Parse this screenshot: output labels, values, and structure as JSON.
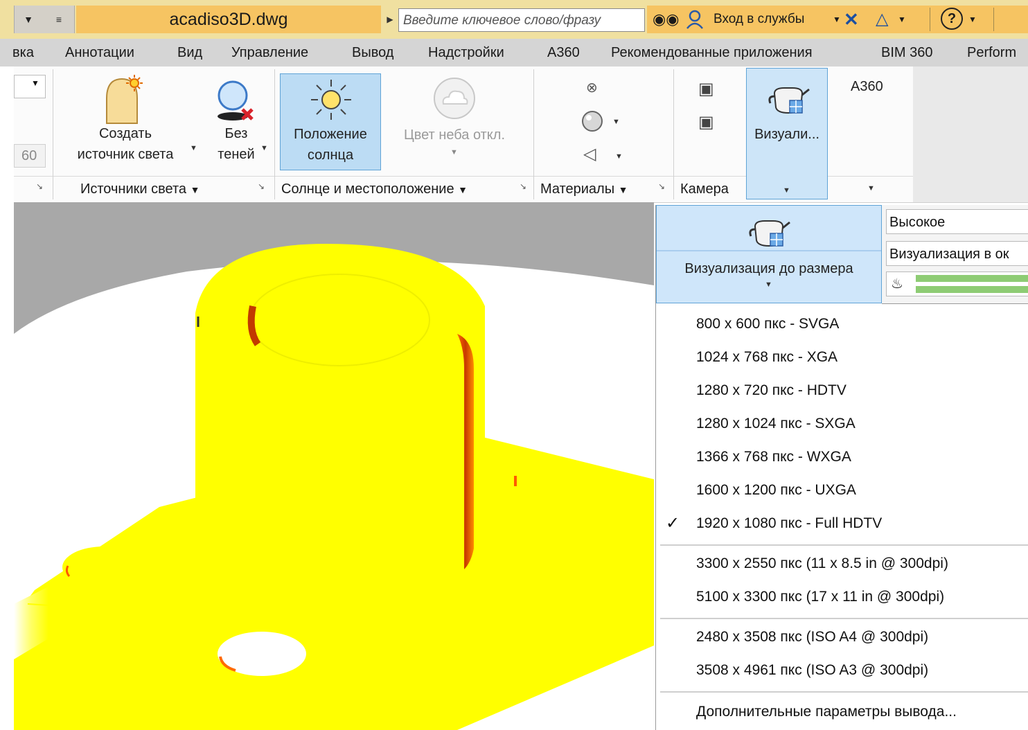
{
  "title_bar": {
    "doc_title": "acadiso3D.dwg",
    "search_placeholder": "Введите ключевое слово/фразу",
    "sign_in": "Вход в службы",
    "help": "?"
  },
  "tabs": [
    "вка",
    "Аннотации",
    "Вид",
    "Управление",
    "Вывод",
    "Надстройки",
    "A360",
    "Рекомендованные приложения",
    "BIM 360",
    "Perform"
  ],
  "ribbon": {
    "left_field_value": "60",
    "create_light": [
      "Создать",
      "источник света"
    ],
    "no_shadows": [
      "Без",
      "теней"
    ],
    "sun_status": [
      "Положение",
      "солнца"
    ],
    "sky_off": "Цвет неба откл.",
    "render_label": "Визуали...",
    "a360_label": "A360",
    "panels": {
      "lights": "Источники света",
      "sun_location": "Солнце и местоположение",
      "materials": "Материалы",
      "camera": "Камера"
    }
  },
  "render_dropdown": {
    "big_button_label": "Визуализация до размера",
    "quality": "Высокое",
    "render_in": "Визуализация в ок",
    "items": [
      {
        "label": "800 x 600 пкс - SVGA",
        "checked": false
      },
      {
        "label": "1024 x 768 пкс - XGA",
        "checked": false
      },
      {
        "label": "1280 x 720 пкс - HDTV",
        "checked": false
      },
      {
        "label": "1280 x 1024 пкс - SXGA",
        "checked": false
      },
      {
        "label": "1366 x 768 пкс - WXGA",
        "checked": false
      },
      {
        "label": "1600 x 1200 пкс - UXGA",
        "checked": false
      },
      {
        "label": "1920 x 1080 пкс - Full HDTV",
        "checked": true
      },
      {
        "label": "3300 x 2550 пкс (11 x 8.5 in @ 300dpi)",
        "checked": false
      },
      {
        "label": "5100 x 3300 пкс (17 x 11 in @ 300dpi)",
        "checked": false
      },
      {
        "label": "2480 x 3508 пкс (ISO A4 @ 300dpi)",
        "checked": false
      },
      {
        "label": "3508 x 4961 пкс (ISO A3 @ 300dpi)",
        "checked": false
      },
      {
        "label": "Дополнительные параметры вывода...",
        "checked": false
      }
    ],
    "checkmark": "✓"
  },
  "colors": {
    "title_accent": "#f6c462",
    "model_yellow": "#ffff00",
    "highlight_blue": "#bcdcf4"
  }
}
